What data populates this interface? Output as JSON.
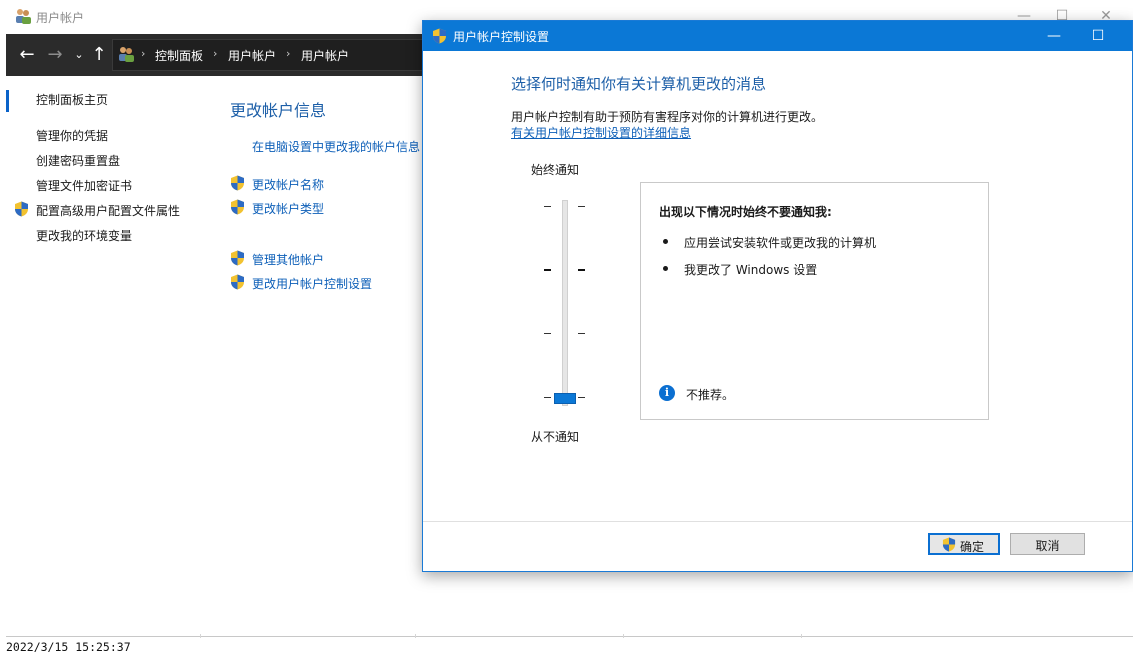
{
  "background_window": {
    "title": "用户帐户",
    "breadcrumbs": [
      "控制面板",
      "用户帐户",
      "用户帐户"
    ],
    "sidebar": {
      "home_link": "控制面板主页",
      "items": [
        "管理你的凭据",
        "创建密码重置盘",
        "管理文件加密证书",
        "配置高级用户配置文件属性",
        "更改我的环境变量"
      ]
    },
    "main": {
      "heading": "更改帐户信息",
      "pc_settings_link": "在电脑设置中更改我的帐户信息",
      "links_group1": [
        "更改帐户名称",
        "更改帐户类型"
      ],
      "links_group2": [
        "管理其他帐户",
        "更改用户帐户控制设置"
      ]
    },
    "controls": {
      "minimize": "—",
      "maximize": "☐",
      "close": "✕"
    }
  },
  "dialog": {
    "title": "用户帐户控制设置",
    "heading": "选择何时通知你有关计算机更改的消息",
    "description": "用户帐户控制有助于预防有害程序对你的计算机进行更改。",
    "more_info_link": "有关用户帐户控制设置的详细信息",
    "slider": {
      "top_label": "始终通知",
      "bottom_label": "从不通知",
      "level": 0,
      "levels": 4
    },
    "info_box": {
      "title": "出现以下情况时始终不要通知我:",
      "bullets": [
        "应用尝试安装软件或更改我的计算机",
        "我更改了 Windows 设置"
      ],
      "note": "不推荐。"
    },
    "ok_label": "确定",
    "cancel_label": "取消",
    "controls": {
      "minimize": "—",
      "maximize": "☐"
    }
  },
  "timestamp": "2022/3/15 15:25:37",
  "colors": {
    "accent": "#0b78d6",
    "link": "#0d5fb8",
    "heading": "#1d5fa8",
    "nav_bg": "#2b2b2b"
  }
}
